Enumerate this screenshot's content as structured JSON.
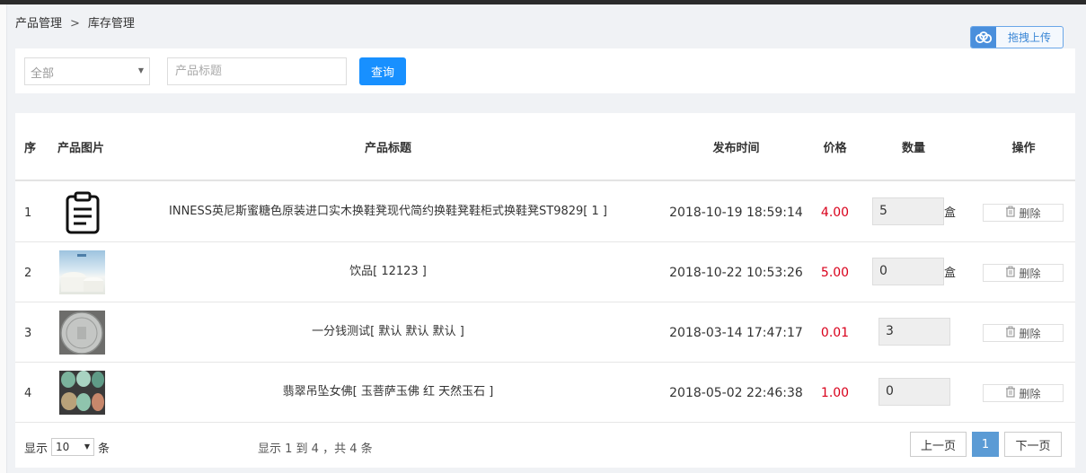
{
  "breadcrumb": {
    "parent": "产品管理",
    "separator": ">",
    "current": "库存管理"
  },
  "upload": {
    "label": "拖拽上传",
    "icon": "cloud-upload-icon"
  },
  "search": {
    "category_value": "全部",
    "title_placeholder": "产品标题",
    "query_label": "查询"
  },
  "table": {
    "headers": {
      "index": "序",
      "image": "产品图片",
      "title": "产品标题",
      "time": "发布时间",
      "price": "价格",
      "quantity": "数量",
      "actions": "操作"
    },
    "rows": [
      {
        "index": "1",
        "image": "clipboard-icon",
        "title": "INNESS英尼斯蜜糖色原装进口实木换鞋凳现代简约换鞋凳鞋柜式换鞋凳ST9829[ 1 ]",
        "time": "2018-10-19 18:59:14",
        "price": "4.00",
        "quantity": "5",
        "unit": "盒",
        "delete_label": "删除"
      },
      {
        "index": "2",
        "image": "drink-photo",
        "title": "饮品[ 12123 ]",
        "time": "2018-10-22 10:53:26",
        "price": "5.00",
        "quantity": "0",
        "unit": "盒",
        "delete_label": "删除"
      },
      {
        "index": "3",
        "image": "coin-photo",
        "title": "一分钱测试[ 默认 默认 默认 ]",
        "time": "2018-03-14 17:47:17",
        "price": "0.01",
        "quantity": "3",
        "unit": "",
        "delete_label": "删除"
      },
      {
        "index": "4",
        "image": "jade-photo",
        "title": "翡翠吊坠女佛[ 玉菩萨玉佛 红 天然玉石 ]",
        "time": "2018-05-02 22:46:38",
        "price": "1.00",
        "quantity": "0",
        "unit": "",
        "delete_label": "删除"
      }
    ]
  },
  "footer": {
    "show_label": "显示",
    "page_size": "10",
    "unit_label": "条",
    "info": "显示 1 到 4 ，共 4 条",
    "prev": "上一页",
    "current_page": "1",
    "next": "下一页"
  },
  "colors": {
    "primary": "#1890ff",
    "price": "#d9001b",
    "page_active": "#5b9bd5"
  }
}
